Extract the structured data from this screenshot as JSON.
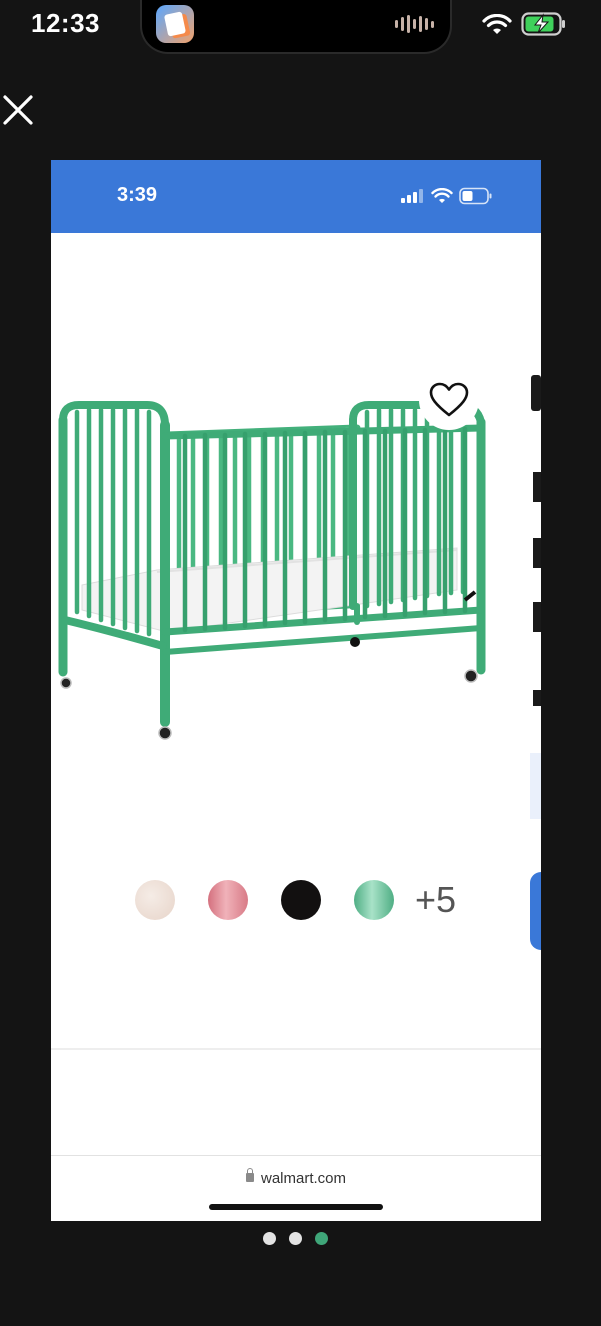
{
  "os_status": {
    "time": "12:33"
  },
  "inner_status": {
    "time": "3:39"
  },
  "product": {
    "favorite_icon": "heart-outline-icon",
    "swatches": [
      {
        "name": "blush",
        "color": "#eadbd1"
      },
      {
        "name": "pink",
        "color": "#de8a95"
      },
      {
        "name": "black",
        "color": "#121010"
      },
      {
        "name": "green",
        "color": "#5fbf93"
      }
    ],
    "more_colors": "+5"
  },
  "browser": {
    "url": "walmart.com"
  },
  "pager": {
    "total": 3,
    "active_index": 2
  }
}
